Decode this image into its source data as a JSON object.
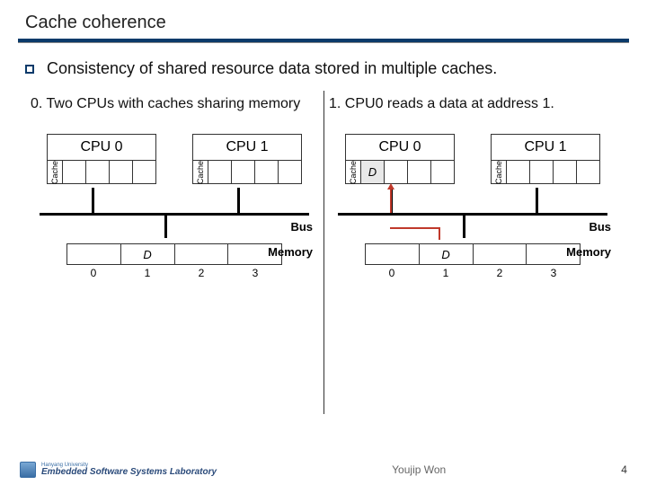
{
  "title": "Cache coherence",
  "bullet": "Consistency of shared resource data stored in multiple caches.",
  "steps": {
    "left": "0. Two CPUs with caches sharing memory",
    "right": "1. CPU0 reads a data at address 1."
  },
  "cpu": {
    "cpu0": "CPU 0",
    "cpu1": "CPU 1",
    "cache_label": "Cache"
  },
  "memory": {
    "label": "Memory",
    "bus": "Bus",
    "data_symbol": "D",
    "indices": [
      "0",
      "1",
      "2",
      "3"
    ]
  },
  "footer": {
    "univ": "Hanyang University",
    "lab": "Embedded Software Systems Laboratory",
    "author": "Youjip Won",
    "page": "4"
  },
  "chart_data": {
    "type": "diagram",
    "description": "Cache coherence illustration with two CPU/cache blocks connected by a bus to shared memory. Left panel: initial state, memory address 1 holds data D. Right panel: CPU0 reads address 1; D copied into CPU0 cache; red arrow shows read path from memory[1] via bus to CPU0 cache.",
    "panels": [
      {
        "step": 0,
        "caption": "Two CPUs with caches sharing memory",
        "cpu0_cache": [
          null,
          null,
          null,
          null
        ],
        "cpu1_cache": [
          null,
          null,
          null,
          null
        ],
        "memory": [
          null,
          "D",
          null,
          null
        ]
      },
      {
        "step": 1,
        "caption": "CPU0 reads a data at address 1.",
        "cpu0_cache": [
          "D",
          null,
          null,
          null
        ],
        "cpu1_cache": [
          null,
          null,
          null,
          null
        ],
        "memory": [
          null,
          "D",
          null,
          null
        ],
        "read_arrow": {
          "from": "memory[1]",
          "to": "cpu0.cache",
          "color": "red"
        }
      }
    ]
  }
}
